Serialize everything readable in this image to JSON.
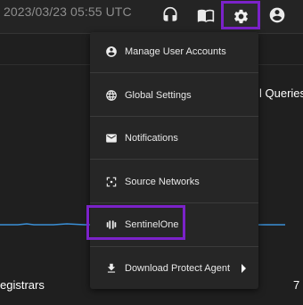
{
  "header": {
    "timestamp": "2023/03/23 05:55 UTC",
    "icons": [
      "headset-icon",
      "book-icon",
      "gear-icon",
      "account-circle-icon"
    ]
  },
  "background": {
    "queries_label": "l Queries",
    "registrars_label": "egistrars",
    "count": "7"
  },
  "menu": {
    "items": [
      {
        "label": "Manage User Accounts",
        "icon": "account-circle-icon"
      },
      {
        "label": "Global Settings",
        "icon": "globe-icon"
      },
      {
        "label": "Notifications",
        "icon": "mail-icon"
      },
      {
        "label": "Source Networks",
        "icon": "fullscreen-icon"
      },
      {
        "label": "SentinelOne",
        "icon": "sentinelone-logo-icon"
      },
      {
        "label": "Download Protect Agent",
        "icon": "download-icon"
      }
    ]
  },
  "colors": {
    "highlight": "#7b22c9",
    "chart_line": "#3a8fd6",
    "menu_bg": "#262626"
  }
}
